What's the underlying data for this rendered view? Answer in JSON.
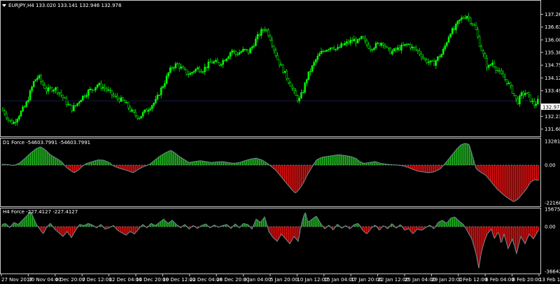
{
  "window": {
    "symbol_header": "EURJPY,H4  133.020 133.141 132.946 132.978",
    "dropdown_icon": "triangle-down-icon"
  },
  "colors": {
    "background": "#000000",
    "bull_candle": "#00ff00",
    "bear_candle": "#000000",
    "candle_outline": "#00ff00",
    "grid": "#1a1a4a",
    "axis_text": "#ffffff",
    "positive_bar": "#1fb51f",
    "negative_bar": "#e01010",
    "indicator_line": "#6e8c96",
    "current_price_bg": "#ffffff"
  },
  "price_panel": {
    "tick_labels": [
      "137.260",
      "136.630",
      "136.000",
      "135.385",
      "134.755",
      "134.125",
      "133.495",
      "132.978",
      "132.235",
      "131.605"
    ],
    "tick_values": [
      137.26,
      136.63,
      136.0,
      135.385,
      134.755,
      134.125,
      133.495,
      132.978,
      132.235,
      131.605
    ],
    "current_price": "132.978",
    "ymin": 131.605,
    "ymax": 137.26
  },
  "d1_panel": {
    "header": "D1 Force -54603.7991 -54603.7991",
    "tick_labels": [
      "132811.1",
      "0.00",
      "-221689.0"
    ],
    "tick_values": [
      132811.1,
      0,
      -221689.0
    ]
  },
  "h4_panel": {
    "header": "H4 Force -227.4127 -227.4127",
    "tick_labels": [
      "15675.60",
      "0.00",
      "-36642.97"
    ],
    "tick_values": [
      15675.6,
      0,
      -36642.97
    ]
  },
  "time_axis": {
    "labels": [
      "27 Nov 2017",
      "30 Nov 04:00",
      "4 Dec 20:00",
      "7 Dec 12:00",
      "12 Dec 04:00",
      "14 Dec 20:00",
      "19 Dec 12:00",
      "22 Dec 04:00",
      "28 Dec 20:00",
      "3 Jan 04:00",
      "5 Jan 20:00",
      "10 Jan 12:00",
      "15 Jan 04:00",
      "17 Jan 20:00",
      "22 Jan 12:00",
      "25 Jan 04:00",
      "29 Jan 20:00",
      "1 Feb 12:00",
      "6 Feb 04:00",
      "8 Feb 20:00",
      "13 Feb 12:00"
    ]
  },
  "chart_data": {
    "type": "candlestick",
    "close_path": [
      [
        0,
        132.6
      ],
      [
        6,
        132.4
      ],
      [
        12,
        132.0
      ],
      [
        18,
        131.9
      ],
      [
        24,
        132.2
      ],
      [
        30,
        132.5
      ],
      [
        36,
        132.8
      ],
      [
        42,
        133.4
      ],
      [
        48,
        134.0
      ],
      [
        54,
        134.2
      ],
      [
        60,
        133.8
      ],
      [
        66,
        133.5
      ],
      [
        72,
        133.6
      ],
      [
        78,
        133.6
      ],
      [
        84,
        133.4
      ],
      [
        90,
        133.1
      ],
      [
        96,
        132.8
      ],
      [
        102,
        132.6
      ],
      [
        108,
        132.8
      ],
      [
        114,
        133.1
      ],
      [
        120,
        133.3
      ],
      [
        126,
        133.5
      ],
      [
        132,
        133.6
      ],
      [
        138,
        133.8
      ],
      [
        144,
        133.7
      ],
      [
        150,
        133.6
      ],
      [
        156,
        133.4
      ],
      [
        162,
        133.2
      ],
      [
        168,
        133.1
      ],
      [
        174,
        133.0
      ],
      [
        180,
        132.8
      ],
      [
        186,
        132.5
      ],
      [
        192,
        132.3
      ],
      [
        198,
        132.2
      ],
      [
        204,
        132.4
      ],
      [
        210,
        132.6
      ],
      [
        216,
        132.8
      ],
      [
        222,
        133.0
      ],
      [
        228,
        133.5
      ],
      [
        234,
        133.9
      ],
      [
        240,
        134.4
      ],
      [
        246,
        134.7
      ],
      [
        252,
        134.8
      ],
      [
        258,
        134.6
      ],
      [
        264,
        134.4
      ],
      [
        270,
        134.3
      ],
      [
        276,
        134.5
      ],
      [
        282,
        134.6
      ],
      [
        288,
        134.5
      ],
      [
        294,
        134.7
      ],
      [
        300,
        134.9
      ],
      [
        306,
        134.9
      ],
      [
        312,
        134.8
      ],
      [
        318,
        135.0
      ],
      [
        324,
        135.2
      ],
      [
        330,
        135.5
      ],
      [
        336,
        135.3
      ],
      [
        342,
        135.4
      ],
      [
        348,
        135.5
      ],
      [
        354,
        135.4
      ],
      [
        360,
        135.7
      ],
      [
        366,
        136.1
      ],
      [
        372,
        136.4
      ],
      [
        378,
        136.6
      ],
      [
        384,
        136.2
      ],
      [
        390,
        135.6
      ],
      [
        396,
        135.0
      ],
      [
        402,
        134.6
      ],
      [
        408,
        134.2
      ],
      [
        414,
        133.8
      ],
      [
        420,
        133.3
      ],
      [
        426,
        133.0
      ],
      [
        432,
        133.5
      ],
      [
        438,
        134.2
      ],
      [
        444,
        134.6
      ],
      [
        450,
        135.0
      ],
      [
        456,
        135.3
      ],
      [
        462,
        135.5
      ],
      [
        468,
        135.6
      ],
      [
        474,
        135.7
      ],
      [
        480,
        135.5
      ],
      [
        486,
        135.7
      ],
      [
        492,
        135.8
      ],
      [
        498,
        135.9
      ],
      [
        504,
        136.0
      ],
      [
        510,
        135.9
      ],
      [
        516,
        136.1
      ],
      [
        522,
        135.8
      ],
      [
        528,
        135.6
      ],
      [
        534,
        135.7
      ],
      [
        540,
        135.8
      ],
      [
        546,
        135.9
      ],
      [
        552,
        135.5
      ],
      [
        558,
        135.4
      ],
      [
        564,
        135.5
      ],
      [
        570,
        135.6
      ],
      [
        576,
        135.7
      ],
      [
        582,
        135.8
      ],
      [
        588,
        135.6
      ],
      [
        594,
        135.5
      ],
      [
        600,
        135.3
      ],
      [
        606,
        135.0
      ],
      [
        612,
        134.9
      ],
      [
        618,
        134.8
      ],
      [
        624,
        135.1
      ],
      [
        630,
        135.3
      ],
      [
        636,
        135.8
      ],
      [
        642,
        136.4
      ],
      [
        648,
        136.5
      ],
      [
        654,
        136.9
      ],
      [
        660,
        137.1
      ],
      [
        666,
        137.2
      ],
      [
        672,
        136.9
      ],
      [
        678,
        136.6
      ],
      [
        684,
        135.8
      ],
      [
        690,
        135.2
      ],
      [
        696,
        134.6
      ],
      [
        702,
        134.9
      ],
      [
        708,
        134.6
      ],
      [
        714,
        134.3
      ],
      [
        720,
        134.1
      ],
      [
        726,
        133.8
      ],
      [
        732,
        133.4
      ],
      [
        738,
        132.9
      ],
      [
        744,
        133.3
      ],
      [
        750,
        133.4
      ],
      [
        756,
        133.1
      ],
      [
        762,
        132.8
      ],
      [
        768,
        133.0
      ]
    ],
    "d1_force": [
      [
        0,
        5000
      ],
      [
        10,
        3000
      ],
      [
        20,
        -2000
      ],
      [
        28,
        12000
      ],
      [
        36,
        40000
      ],
      [
        44,
        70000
      ],
      [
        52,
        95000
      ],
      [
        58,
        105000
      ],
      [
        64,
        90000
      ],
      [
        72,
        60000
      ],
      [
        80,
        40000
      ],
      [
        88,
        20000
      ],
      [
        94,
        -10000
      ],
      [
        100,
        -30000
      ],
      [
        106,
        -45000
      ],
      [
        112,
        -30000
      ],
      [
        118,
        -5000
      ],
      [
        124,
        10000
      ],
      [
        132,
        20000
      ],
      [
        140,
        30000
      ],
      [
        148,
        28000
      ],
      [
        156,
        15000
      ],
      [
        162,
        -5000
      ],
      [
        168,
        -15000
      ],
      [
        176,
        -25000
      ],
      [
        184,
        -35000
      ],
      [
        190,
        -45000
      ],
      [
        196,
        -30000
      ],
      [
        202,
        -15000
      ],
      [
        208,
        -5000
      ],
      [
        214,
        5000
      ],
      [
        220,
        25000
      ],
      [
        228,
        50000
      ],
      [
        236,
        70000
      ],
      [
        244,
        85000
      ],
      [
        250,
        70000
      ],
      [
        256,
        50000
      ],
      [
        264,
        30000
      ],
      [
        270,
        15000
      ],
      [
        278,
        20000
      ],
      [
        286,
        25000
      ],
      [
        294,
        20000
      ],
      [
        302,
        15000
      ],
      [
        310,
        18000
      ],
      [
        318,
        20000
      ],
      [
        326,
        15000
      ],
      [
        334,
        10000
      ],
      [
        342,
        15000
      ],
      [
        350,
        25000
      ],
      [
        358,
        35000
      ],
      [
        366,
        40000
      ],
      [
        374,
        30000
      ],
      [
        382,
        10000
      ],
      [
        388,
        -10000
      ],
      [
        394,
        -30000
      ],
      [
        400,
        -60000
      ],
      [
        408,
        -100000
      ],
      [
        416,
        -140000
      ],
      [
        422,
        -165000
      ],
      [
        428,
        -140000
      ],
      [
        434,
        -100000
      ],
      [
        440,
        -50000
      ],
      [
        446,
        -10000
      ],
      [
        452,
        30000
      ],
      [
        460,
        45000
      ],
      [
        468,
        50000
      ],
      [
        476,
        55000
      ],
      [
        484,
        60000
      ],
      [
        492,
        55000
      ],
      [
        500,
        50000
      ],
      [
        508,
        40000
      ],
      [
        514,
        20000
      ],
      [
        520,
        10000
      ],
      [
        528,
        15000
      ],
      [
        536,
        20000
      ],
      [
        544,
        10000
      ],
      [
        552,
        5000
      ],
      [
        560,
        2000
      ],
      [
        568,
        0
      ],
      [
        576,
        -5000
      ],
      [
        584,
        -15000
      ],
      [
        590,
        -25000
      ],
      [
        596,
        -35000
      ],
      [
        604,
        -40000
      ],
      [
        612,
        -45000
      ],
      [
        620,
        -40000
      ],
      [
        628,
        -25000
      ],
      [
        634,
        0
      ],
      [
        640,
        30000
      ],
      [
        646,
        60000
      ],
      [
        652,
        90000
      ],
      [
        658,
        115000
      ],
      [
        664,
        125000
      ],
      [
        670,
        120000
      ],
      [
        676,
        40000
      ],
      [
        680,
        -20000
      ],
      [
        686,
        -40000
      ],
      [
        694,
        -60000
      ],
      [
        702,
        -100000
      ],
      [
        710,
        -140000
      ],
      [
        718,
        -170000
      ],
      [
        726,
        -195000
      ],
      [
        734,
        -215000
      ],
      [
        740,
        -200000
      ],
      [
        746,
        -170000
      ],
      [
        752,
        -140000
      ],
      [
        758,
        -100000
      ],
      [
        764,
        -85000
      ],
      [
        770,
        -90000
      ]
    ],
    "h4_force": [
      [
        0,
        1500
      ],
      [
        8,
        3000
      ],
      [
        14,
        -1000
      ],
      [
        20,
        4000
      ],
      [
        26,
        2000
      ],
      [
        32,
        6000
      ],
      [
        38,
        10000
      ],
      [
        44,
        14000
      ],
      [
        48,
        8000
      ],
      [
        52,
        2000
      ],
      [
        58,
        -3000
      ],
      [
        62,
        -6000
      ],
      [
        66,
        -1000
      ],
      [
        72,
        3000
      ],
      [
        78,
        -2000
      ],
      [
        84,
        -5000
      ],
      [
        90,
        -8000
      ],
      [
        96,
        -4000
      ],
      [
        102,
        -9000
      ],
      [
        108,
        -3000
      ],
      [
        114,
        2000
      ],
      [
        120,
        1000
      ],
      [
        126,
        3000
      ],
      [
        132,
        1500
      ],
      [
        138,
        -1000
      ],
      [
        144,
        2000
      ],
      [
        150,
        -2000
      ],
      [
        156,
        -1000
      ],
      [
        162,
        1000
      ],
      [
        168,
        -3000
      ],
      [
        174,
        -5000
      ],
      [
        180,
        -7000
      ],
      [
        186,
        -4000
      ],
      [
        192,
        -6000
      ],
      [
        198,
        -2000
      ],
      [
        204,
        2000
      ],
      [
        210,
        -1000
      ],
      [
        216,
        3000
      ],
      [
        222,
        1000
      ],
      [
        228,
        4000
      ],
      [
        234,
        7000
      ],
      [
        240,
        3000
      ],
      [
        246,
        6000
      ],
      [
        252,
        2000
      ],
      [
        258,
        -1000
      ],
      [
        264,
        2000
      ],
      [
        270,
        -2000
      ],
      [
        276,
        1000
      ],
      [
        282,
        -1500
      ],
      [
        288,
        1000
      ],
      [
        294,
        2500
      ],
      [
        300,
        -1000
      ],
      [
        306,
        1500
      ],
      [
        312,
        -500
      ],
      [
        318,
        1000
      ],
      [
        324,
        2000
      ],
      [
        330,
        -1500
      ],
      [
        336,
        2500
      ],
      [
        342,
        -1000
      ],
      [
        348,
        3000
      ],
      [
        354,
        2000
      ],
      [
        360,
        -2000
      ],
      [
        366,
        7000
      ],
      [
        372,
        4000
      ],
      [
        378,
        9000
      ],
      [
        384,
        -4000
      ],
      [
        390,
        -9000
      ],
      [
        396,
        -12000
      ],
      [
        402,
        -6000
      ],
      [
        408,
        -10000
      ],
      [
        414,
        -14000
      ],
      [
        420,
        -8000
      ],
      [
        426,
        -12000
      ],
      [
        432,
        6000
      ],
      [
        436,
        14000
      ],
      [
        440,
        4000
      ],
      [
        446,
        7000
      ],
      [
        452,
        10000
      ],
      [
        458,
        3000
      ],
      [
        464,
        -2000
      ],
      [
        470,
        1500
      ],
      [
        476,
        -3000
      ],
      [
        482,
        2500
      ],
      [
        488,
        -1500
      ],
      [
        494,
        1000
      ],
      [
        500,
        -2000
      ],
      [
        506,
        2000
      ],
      [
        512,
        3000
      ],
      [
        518,
        -3000
      ],
      [
        524,
        -6000
      ],
      [
        530,
        -1500
      ],
      [
        536,
        1500
      ],
      [
        542,
        -3000
      ],
      [
        548,
        1000
      ],
      [
        554,
        -2000
      ],
      [
        560,
        3000
      ],
      [
        566,
        -1500
      ],
      [
        572,
        2000
      ],
      [
        578,
        -3000
      ],
      [
        584,
        -1500
      ],
      [
        590,
        -6000
      ],
      [
        596,
        -2000
      ],
      [
        602,
        -3000
      ],
      [
        608,
        -1000
      ],
      [
        614,
        1500
      ],
      [
        620,
        -2000
      ],
      [
        626,
        4000
      ],
      [
        632,
        6000
      ],
      [
        638,
        3000
      ],
      [
        644,
        8000
      ],
      [
        650,
        9000
      ],
      [
        656,
        5000
      ],
      [
        662,
        2000
      ],
      [
        668,
        -4000
      ],
      [
        674,
        -10000
      ],
      [
        680,
        -22000
      ],
      [
        684,
        -34000
      ],
      [
        688,
        -20000
      ],
      [
        692,
        -12000
      ],
      [
        696,
        -6000
      ],
      [
        702,
        -2000
      ],
      [
        706,
        -10000
      ],
      [
        712,
        -4000
      ],
      [
        716,
        -14000
      ],
      [
        720,
        -6000
      ],
      [
        726,
        -18000
      ],
      [
        732,
        -10000
      ],
      [
        738,
        -22000
      ],
      [
        744,
        -8000
      ],
      [
        750,
        -14000
      ],
      [
        756,
        -6000
      ],
      [
        762,
        -10000
      ],
      [
        768,
        -4000
      ],
      [
        772,
        -2000
      ]
    ]
  }
}
